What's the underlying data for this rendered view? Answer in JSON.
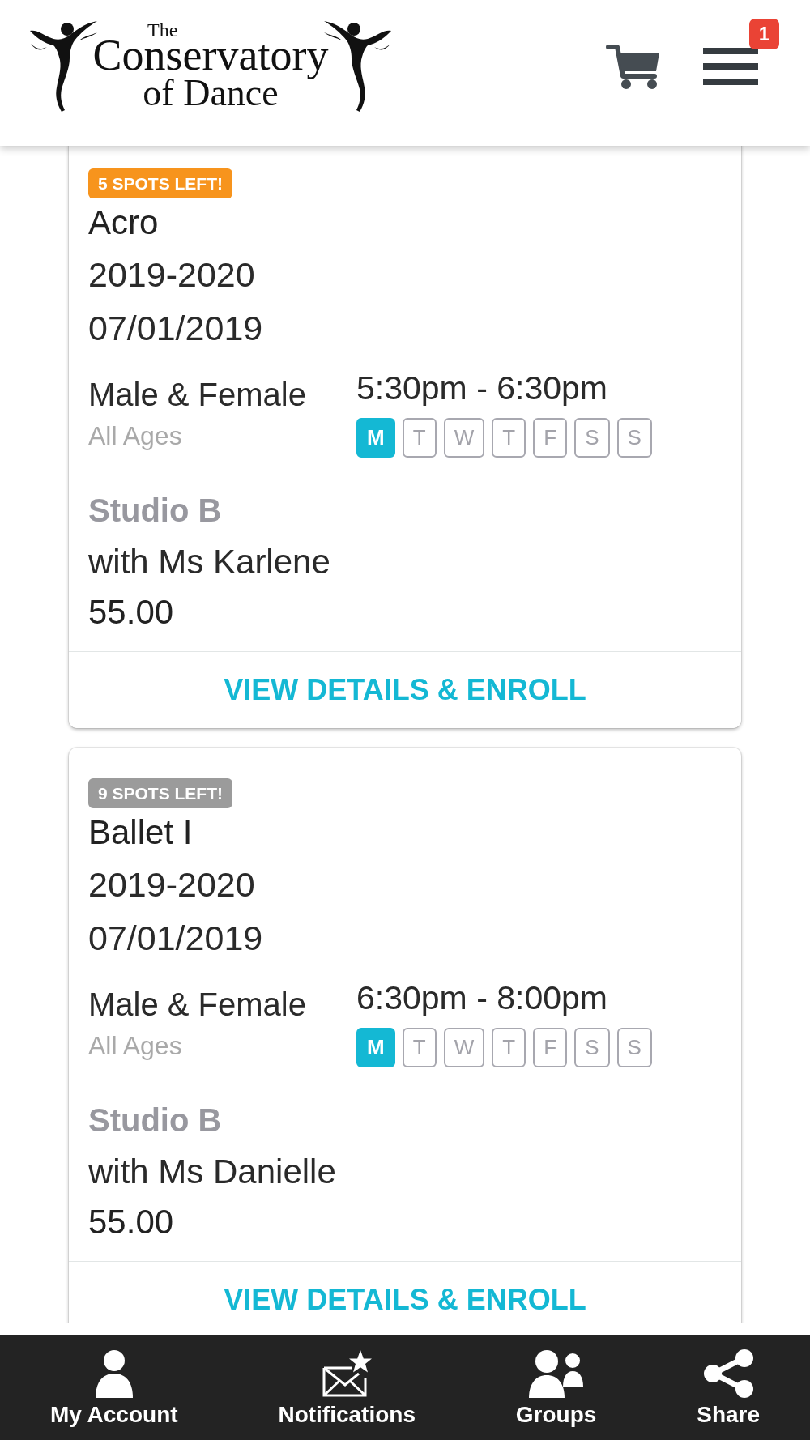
{
  "header": {
    "logo": {
      "line_1": "The",
      "line_2": "Conservatory",
      "line_3": "of Dance"
    },
    "menu_badge": "1"
  },
  "classes": [
    {
      "availability": {
        "text": "5 SPOTS LEFT!",
        "color": "#f7941d"
      },
      "name": "Acro",
      "season": "2019-2020",
      "start_date": "07/01/2019",
      "gender": "Male & Female",
      "ages": "All Ages",
      "time": "5:30pm - 6:30pm",
      "days": [
        {
          "label": "M",
          "active": true
        },
        {
          "label": "T",
          "active": false
        },
        {
          "label": "W",
          "active": false
        },
        {
          "label": "T",
          "active": false
        },
        {
          "label": "F",
          "active": false
        },
        {
          "label": "S",
          "active": false
        },
        {
          "label": "S",
          "active": false
        }
      ],
      "room": "Studio B",
      "instructor": "with Ms Karlene",
      "price": "55.00",
      "action": "VIEW DETAILS & ENROLL"
    },
    {
      "availability": {
        "text": "9 SPOTS LEFT!",
        "color": "#9b9b9b"
      },
      "name": "Ballet I",
      "season": "2019-2020",
      "start_date": "07/01/2019",
      "gender": "Male & Female",
      "ages": "All Ages",
      "time": "6:30pm - 8:00pm",
      "days": [
        {
          "label": "M",
          "active": true
        },
        {
          "label": "T",
          "active": false
        },
        {
          "label": "W",
          "active": false
        },
        {
          "label": "T",
          "active": false
        },
        {
          "label": "F",
          "active": false
        },
        {
          "label": "S",
          "active": false
        },
        {
          "label": "S",
          "active": false
        }
      ],
      "room": "Studio B",
      "instructor": "with Ms Danielle",
      "price": "55.00",
      "action": "VIEW DETAILS & ENROLL"
    }
  ],
  "bottom_nav": [
    "My Account",
    "Notifications",
    "Groups",
    "Share"
  ]
}
